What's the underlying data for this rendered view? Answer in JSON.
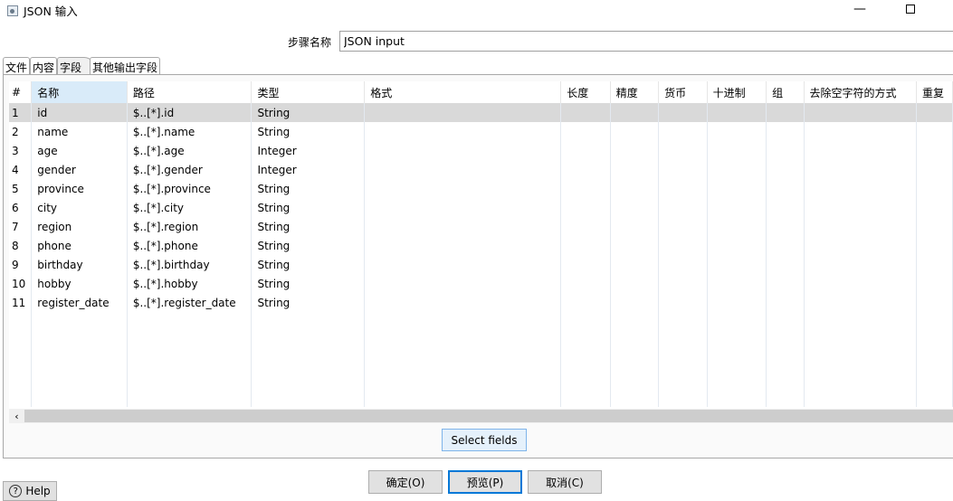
{
  "window": {
    "title": "JSON 输入",
    "minimize_icon": "minimize-icon",
    "maximize_icon": "maximize-icon"
  },
  "step": {
    "label": "步骤名称",
    "value": "JSON input"
  },
  "tabs": [
    {
      "label": "文件"
    },
    {
      "label": "内容"
    },
    {
      "label": "字段",
      "active": true
    },
    {
      "label": "其他输出字段"
    }
  ],
  "table": {
    "columns": [
      "#",
      "名称",
      "路径",
      "类型",
      "格式",
      "长度",
      "精度",
      "货币",
      "十进制",
      "组",
      "去除空字符的方式",
      "重复"
    ],
    "rows": [
      [
        "1",
        "id",
        "$..[*].id",
        "String"
      ],
      [
        "2",
        "name",
        "$..[*].name",
        "String"
      ],
      [
        "3",
        "age",
        "$..[*].age",
        "Integer"
      ],
      [
        "4",
        "gender",
        "$..[*].gender",
        "Integer"
      ],
      [
        "5",
        "province",
        "$..[*].province",
        "String"
      ],
      [
        "6",
        "city",
        "$..[*].city",
        "String"
      ],
      [
        "7",
        "region",
        "$..[*].region",
        "String"
      ],
      [
        "8",
        "phone",
        "$..[*].phone",
        "String"
      ],
      [
        "9",
        "birthday",
        "$..[*].birthday",
        "String"
      ],
      [
        "10",
        "hobby",
        "$..[*].hobby",
        "String"
      ],
      [
        "11",
        "register_date",
        "$..[*].register_date",
        "String"
      ]
    ],
    "selected_row": 1
  },
  "buttons": {
    "select_fields": "Select fields",
    "ok": "确定(O)",
    "preview": "预览(P)",
    "cancel": "取消(C)",
    "help": "Help"
  }
}
